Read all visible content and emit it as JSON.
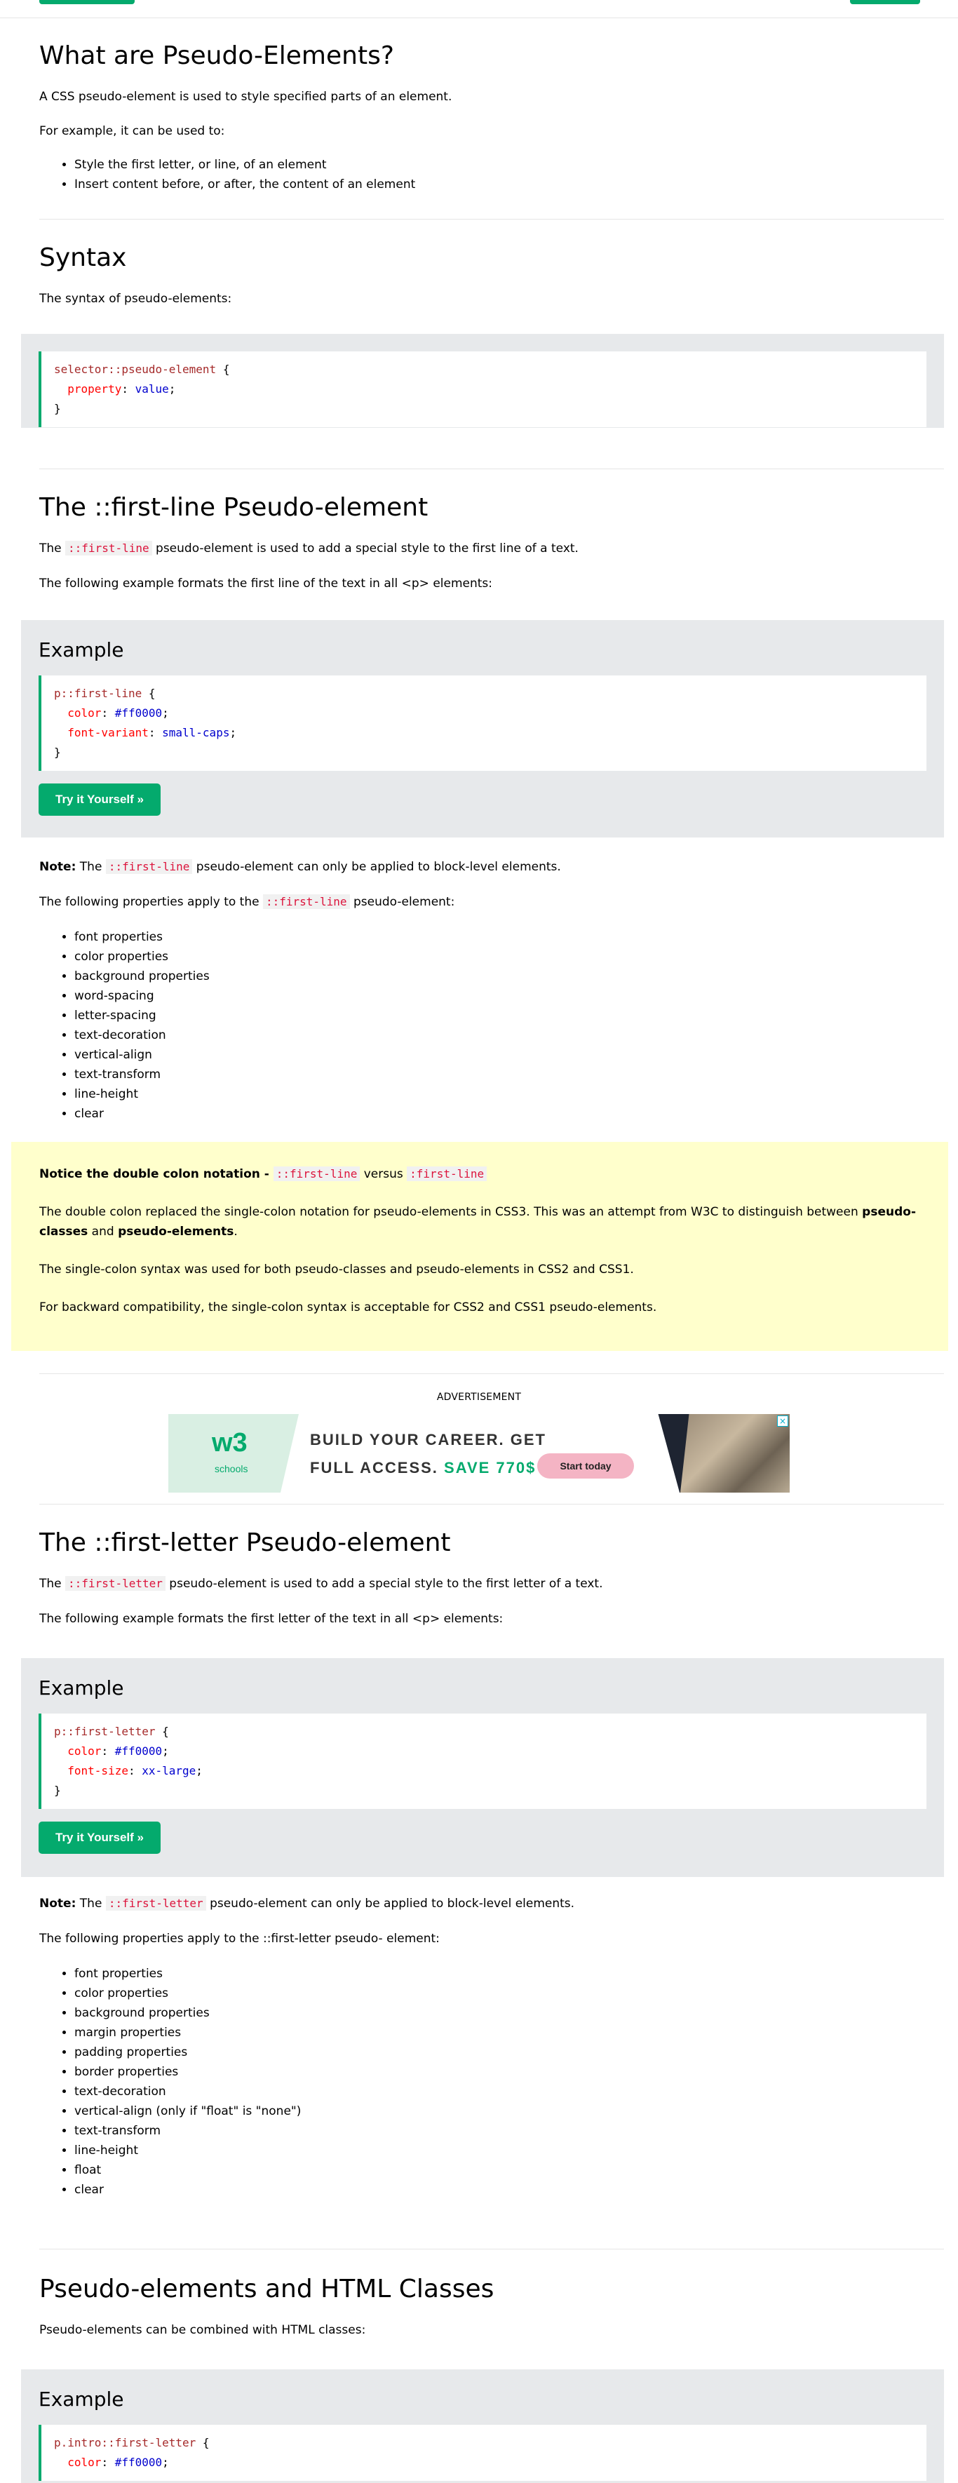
{
  "intro": {
    "title": "What are Pseudo-Elements?",
    "p1": "A CSS pseudo-element is used to style specified parts of an element.",
    "p2": "For example, it can be used to:",
    "items": [
      "Style the first letter, or line, of an element",
      "Insert content before, or after, the content of an element"
    ]
  },
  "syntax": {
    "title": "Syntax",
    "p1": "The syntax of pseudo-elements:",
    "code_selector": "selector::pseudo-element",
    "code_prop": "property",
    "code_value": "value"
  },
  "first_line": {
    "title": "The ::first-line Pseudo-element",
    "p1_before": "The ",
    "p1_code": "::first-line",
    "p1_after": " pseudo-element is used to add a special style to the first line of a text.",
    "p2": "The following example formats the first line of the text in all <p> elements:",
    "example_title": "Example",
    "code_selector": "p::first-line",
    "code_p1": "color",
    "code_v1": "#ff0000",
    "code_p2": "font-variant",
    "code_v2": "small-caps",
    "try_label": "Try it Yourself »",
    "note_label": "Note:",
    "note_before": " The ",
    "note_code": "::first-line",
    "note_after": " pseudo-element can only be applied to block-level elements.",
    "props_before": "The following properties apply to the ",
    "props_code": "::first-line",
    "props_after": " pseudo-element:",
    "props": [
      "font properties",
      "color properties",
      "background properties",
      "word-spacing",
      "letter-spacing",
      "text-decoration",
      "vertical-align",
      "text-transform",
      "line-height",
      "clear"
    ]
  },
  "notice": {
    "heading": "Notice the double colon notation - ",
    "code1": "::first-line",
    "versus": " versus ",
    "code2": ":first-line",
    "p1_a": "The double colon replaced the single-colon notation for pseudo-elements in CSS3. This was an attempt from W3C to distinguish between ",
    "p1_b1": "pseudo-classes",
    "p1_and": " and ",
    "p1_b2": "pseudo-elements",
    "p1_end": ".",
    "p2": "The single-colon syntax was used for both pseudo-classes and pseudo-elements in CSS2 and CSS1.",
    "p3": "For backward compatibility, the single-colon syntax is acceptable for CSS2 and CSS1 pseudo-elements."
  },
  "ad": {
    "label": "ADVERTISEMENT",
    "logo_mark": "w3",
    "logo_text": "schools",
    "line1": "BUILD YOUR CAREER. GET",
    "line2_a": "FULL ACCESS. ",
    "line2_b": "SAVE 770$",
    "cta": "Start today",
    "close": "×"
  },
  "first_letter": {
    "title": "The ::first-letter Pseudo-element",
    "p1_before": "The ",
    "p1_code": "::first-letter",
    "p1_after": " pseudo-element is used to add a special style to the first letter of a text.",
    "p2": "The following example formats the first letter of the text in all <p> elements:",
    "example_title": "Example",
    "code_selector": "p::first-letter",
    "code_p1": "color",
    "code_v1": "#ff0000",
    "code_p2": "font-size",
    "code_v2": "xx-large",
    "try_label": "Try it Yourself »",
    "note_label": "Note:",
    "note_before": " The ",
    "note_code": "::first-letter",
    "note_after": " pseudo-element can only be applied to block-level elements.",
    "props_text": "The following properties apply to the ::first-letter pseudo- element:",
    "props": [
      "font properties",
      "color properties",
      "background properties",
      "margin properties",
      "padding properties",
      "border properties",
      "text-decoration",
      "vertical-align (only if \"float\" is \"none\")",
      "text-transform",
      "line-height",
      "float",
      "clear"
    ]
  },
  "classes": {
    "title": "Pseudo-elements and HTML Classes",
    "p1": "Pseudo-elements can be combined with HTML classes:",
    "example_title": "Example",
    "code_selector": "p.intro::first-letter",
    "code_p1": "color",
    "code_v1": "#ff0000"
  }
}
